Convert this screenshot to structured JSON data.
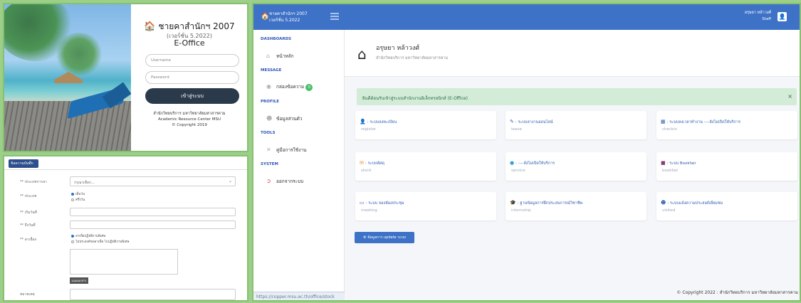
{
  "login": {
    "title": "ชายคาสำนักฯ 2007",
    "version": "(เวอร์ชั่น 5.2022)",
    "app_name": "E-Office",
    "username_placeholder": "Username",
    "password_placeholder": "Password",
    "login_button": "เข้าสู่ระบบ",
    "org_th": "สำนักวิทยบริการ มหาวิทยาลัยมหาสารคาม",
    "org_en": "Academic Resource Center MSU",
    "copyright": "Copyright 2019"
  },
  "form": {
    "header": "ข้อความบันทึก",
    "rows": [
      {
        "label": "** ประเภทการลา",
        "value": "กรุณาเลือก..."
      },
      {
        "label": "** ประเภท"
      },
      {
        "label": "** เริ่มวันที่"
      },
      {
        "label": "** ถึงวันที่"
      },
      {
        "label": "** ลาเนื่อง"
      },
      {
        "label": "หมายเหตุ"
      }
    ],
    "radio1": [
      "เต็มวัน",
      "ครึ่งวัน"
    ],
    "radio2": [
      "ลาเพื่อปฏิบัติงานพิเศษ",
      "ไม่ประสงค์ขอลาเพื่อ ไปปฏิบัติงานพิเศษ"
    ],
    "small_button": "แนบเอกสาร"
  },
  "app": {
    "brand_title": "ชายคาสำนักฯ 2007",
    "brand_version": "เวอร์ชั่น 5.2022",
    "user_name": "อรุษยา หล้าวงศ์",
    "user_role": "Staff",
    "sidebar": [
      {
        "section": "DASHBOARDS",
        "item": "หน้าหลัก",
        "icon": "home-icon"
      },
      {
        "section": "MESSAGE",
        "item": "กล่องข้อความ",
        "icon": "chat-icon",
        "badge": "0"
      },
      {
        "section": "PROFILE",
        "item": "ข้อมูลส่วนตัว",
        "icon": "user-icon"
      },
      {
        "section": "TOOLS",
        "item": "คู่มือการใช้งาน",
        "icon": "tools-icon"
      },
      {
        "section": "SYSTEM",
        "item": "ออกจากระบบ",
        "icon": "logout-icon"
      }
    ],
    "status_url": "https://copper.msu.ac.th/office/stock",
    "header_name": "อรุษยา หล้าวงศ์",
    "header_org": "สำนักวิทยบริการ มหาวิทยาลัยมหาสารคาม",
    "alert_text": "ยินดีต้อนรับเข้าสู่ระบบสำนักงานอิเล็กทรอนิกส์ (E-Office)",
    "cards": [
      {
        "icon": "user-plus-icon",
        "glyph": "👤",
        "title": ": ระบบลงทะเบียน",
        "sub": "register"
      },
      {
        "icon": "leaf-icon",
        "glyph": "✎",
        "title": ": ระบบลางานออนไลน์",
        "sub": "leave"
      },
      {
        "icon": "grid-icon",
        "glyph": "▦",
        "title": ": ระบบลงเวลาทำงาน ----ยังไม่เปิดให้บริการ",
        "sub": "checkin"
      },
      {
        "icon": "box-icon",
        "glyph": "✉",
        "title": ": ระบบพัสดุ",
        "sub": "stock"
      },
      {
        "icon": "info-icon",
        "glyph": "●",
        "title": ": ----ยังไม่เปิดให้บริการ",
        "sub": "service"
      },
      {
        "icon": "book-icon",
        "glyph": "■",
        "title": ": ระบบ Bookfair",
        "sub": "bookfair"
      },
      {
        "icon": "monitor-icon",
        "glyph": "▭",
        "title": ": ระบบ จองห้องประชุม",
        "sub": "meeting"
      },
      {
        "icon": "cap-icon",
        "glyph": "🎓",
        "title": ": ฐานข้อมูลการฝึกประสบการณ์วิชาชีพ",
        "sub": "internship"
      },
      {
        "icon": "people-icon",
        "glyph": "☻",
        "title": ": ระบบแจ้งความประสงค์เยี่ยมชม",
        "sub": "visited"
      }
    ],
    "update_button": "ข้อมูลการ update ระบบ",
    "copyright": "Copyright 2022 : สำนักวิทยบริการ มหาวิทยาลัยมหาสารคาม"
  }
}
